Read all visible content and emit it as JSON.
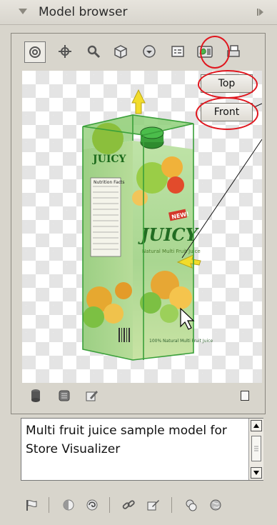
{
  "panel": {
    "title": "Model browser"
  },
  "toolbar": {
    "tools": [
      {
        "icon": "select-tool-icon"
      },
      {
        "icon": "move-tool-icon"
      },
      {
        "icon": "zoom-tool-icon"
      },
      {
        "icon": "box-view-icon"
      },
      {
        "icon": "sphere-view-icon"
      },
      {
        "icon": "checklist-icon"
      },
      {
        "icon": "camera-views-icon"
      },
      {
        "icon": "print-icon"
      }
    ]
  },
  "views": {
    "top_label": "Top",
    "front_label": "Front"
  },
  "model": {
    "brand": "JUICY",
    "product_line": "Natural Multi Fruit Juice",
    "badge": "NEW!",
    "side_text": "100% Natural Multi Fruit Juice",
    "nutrition_header": "Nutrition Facts"
  },
  "bottom_tools": [
    {
      "icon": "cylinder-icon"
    },
    {
      "icon": "scanner-icon"
    },
    {
      "icon": "edit-icon"
    },
    {
      "icon": "small-square-icon"
    }
  ],
  "description": {
    "text": "Multi fruit juice sample model for Store Visualizer"
  },
  "footer_tools": [
    {
      "icon": "flag-icon"
    },
    {
      "icon": "contrast-icon"
    },
    {
      "icon": "swirl-icon"
    },
    {
      "icon": "link-icon"
    },
    {
      "icon": "paint-brush-icon"
    },
    {
      "icon": "cubes-icon"
    },
    {
      "icon": "globe-icon"
    }
  ],
  "colors": {
    "panel_bg": "#d8d5cc",
    "highlight_ring": "#e0151d",
    "selection_green": "#4cb84c",
    "axis_yellow": "#f2dc2a"
  }
}
